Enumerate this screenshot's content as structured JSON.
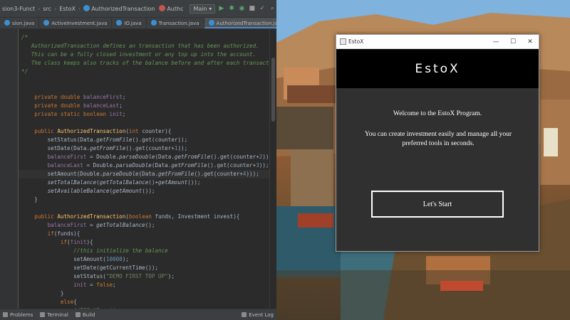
{
  "ide": {
    "breadcrumbs": [
      "sion3-Funct",
      "src",
      "EstoX",
      "AuthorizedTransaction",
      "Authc"
    ],
    "branch": "Main",
    "tabs": [
      {
        "label": "sion.java"
      },
      {
        "label": "ActiveInvestment.java"
      },
      {
        "label": "IO.java"
      },
      {
        "label": "Transaction.java"
      },
      {
        "label": "AuthorizedTransaction.java",
        "active": true
      }
    ],
    "code_lines": [
      {
        "text": "/*",
        "cls": "cm"
      },
      {
        "text": "   AuthorizedTransaction defines an transaction that has been authorized.",
        "cls": "cm"
      },
      {
        "text": "   This can be a fully closed investment or any top up into the account.",
        "cls": "cm"
      },
      {
        "text": "   The class keeps also tracks of the balance before and after each transactio",
        "cls": "cm"
      },
      {
        "text": "*/",
        "cls": "cm"
      },
      {
        "text": "",
        "cls": ""
      },
      {
        "text": "",
        "cls": ""
      },
      {
        "text": "    private double balanceFirst;",
        "cls": "kwline"
      },
      {
        "text": "    private double balanceLast;",
        "cls": "kwline"
      },
      {
        "text": "    private static boolean init;",
        "cls": "kwline"
      },
      {
        "text": "",
        "cls": ""
      },
      {
        "text": "    public AuthorizedTransaction(int counter){",
        "cls": "ctor"
      },
      {
        "text": "        setStatus(Data.getFromFile().get(counter));",
        "cls": ""
      },
      {
        "text": "        setDate(Data.getFromFile().get(counter+1));",
        "cls": ""
      },
      {
        "text": "        balanceFirst = Double.parseDouble(Data.getFromFile().get(counter+2));",
        "cls": ""
      },
      {
        "text": "        balanceLast = Double.parseDouble(Data.getFromFile().get(counter+3));",
        "cls": ""
      },
      {
        "text": "        setAmount(Double.parseDouble(Data.getFromFile().get(counter+4)));",
        "cls": ""
      },
      {
        "text": "        setTotalBalance(getTotalBalance()+getAmount());",
        "cls": ""
      },
      {
        "text": "        setAvailableBalance(getAmount());",
        "cls": ""
      },
      {
        "text": "    }",
        "cls": ""
      },
      {
        "text": "",
        "cls": ""
      },
      {
        "text": "    public AuthorizedTransaction(boolean funds, Investment invest){",
        "cls": "ctor"
      },
      {
        "text": "        balanceFirst = getTotalBalance();",
        "cls": ""
      },
      {
        "text": "        if(funds){",
        "cls": ""
      },
      {
        "text": "            if(!init){",
        "cls": ""
      },
      {
        "text": "                //this initialize the balance",
        "cls": "cm"
      },
      {
        "text": "                setAmount(10000);",
        "cls": ""
      },
      {
        "text": "                setDate(getCurrentTime());",
        "cls": ""
      },
      {
        "text": "                setStatus(\"DEMO FIRST TOP UP\");",
        "cls": ""
      },
      {
        "text": "                init = false;",
        "cls": ""
      },
      {
        "text": "            }",
        "cls": ""
      },
      {
        "text": "            else{",
        "cls": ""
      },
      {
        "text": "                //TOP UP setter",
        "cls": "cm"
      }
    ],
    "status_items": [
      "Problems",
      "Terminal",
      "Build"
    ],
    "event_log": "Event Log"
  },
  "app": {
    "window_title": "EstoX",
    "logo": "EstoX",
    "welcome": "Welcome to the EstoX Program.",
    "description": "You can create investment easily and manage all your preferred tools in seconds.",
    "start_button": "Let's Start"
  },
  "colors": {
    "ide_bg": "#2b2b2b",
    "app_header": "#000000",
    "app_body": "#303030"
  }
}
